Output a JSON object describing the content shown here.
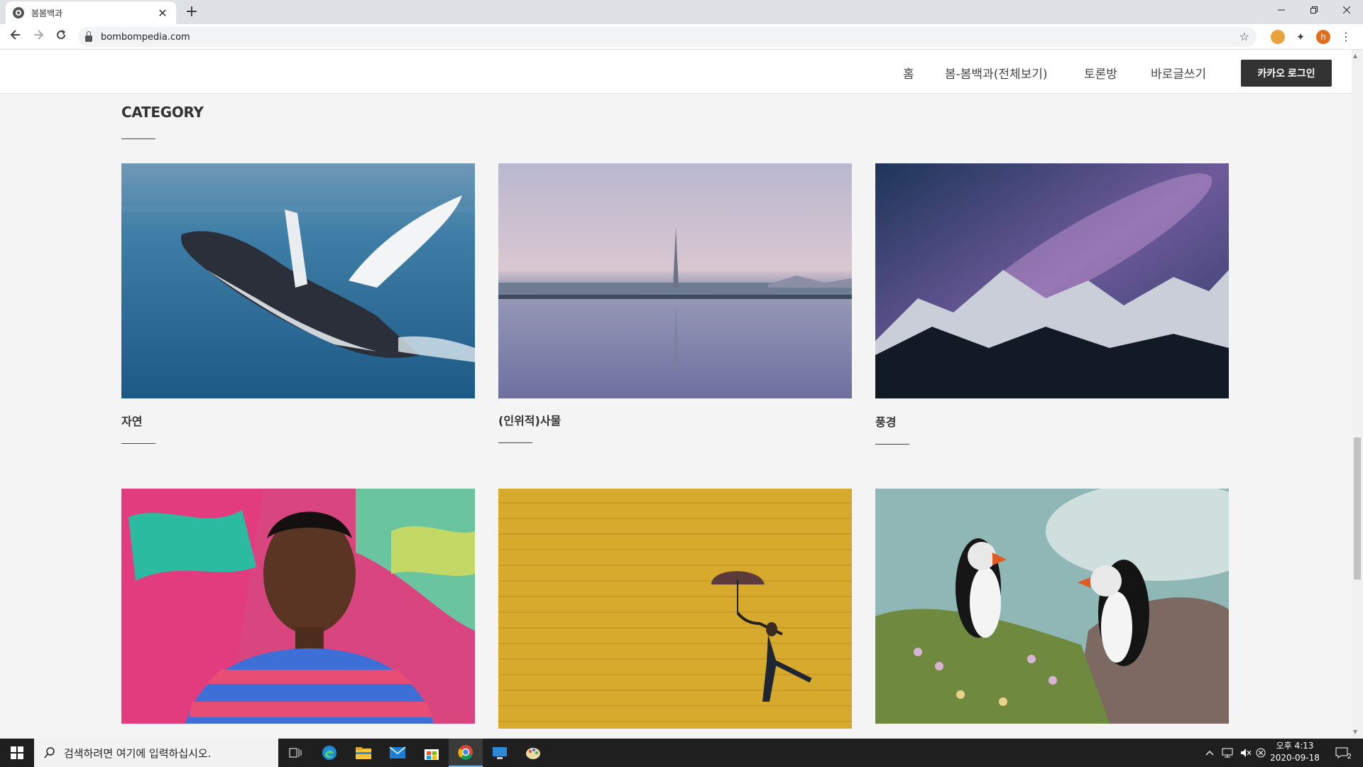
{
  "browser": {
    "tab_title": "봄봄백과",
    "new_tab_symbol": "+",
    "close_symbol": "✕",
    "url": "bombompedia.com",
    "profile_initial": "h"
  },
  "site": {
    "nav": [
      "홈",
      "봄-봄백과(전체보기)",
      "토론방",
      "바로글쓰기"
    ],
    "login_label": "카카오 로그인",
    "category_title": "CATEGORY",
    "cards": [
      {
        "label": "자연",
        "image": "humpback whale breaching"
      },
      {
        "label": "(인위적)사물",
        "image": "city skyline with tower reflected in water"
      },
      {
        "label": "풍경",
        "image": "milky way over snowy mountains"
      },
      {
        "label": "",
        "image": "man in striped shirt before graffiti wall"
      },
      {
        "label": "",
        "image": "woman with umbrella against yellow wall"
      },
      {
        "label": "",
        "image": "two puffins on flowery cliff"
      }
    ]
  },
  "taskbar": {
    "search_placeholder": "검색하려면 여기에 입력하십시오.",
    "time": "오후 4:13",
    "date": "2020-09-18",
    "notification_count": "2"
  },
  "colors": {
    "page_bg": "#f4f4f4",
    "login_bg": "#333333",
    "taskbar_bg": "#1f1f1f"
  }
}
